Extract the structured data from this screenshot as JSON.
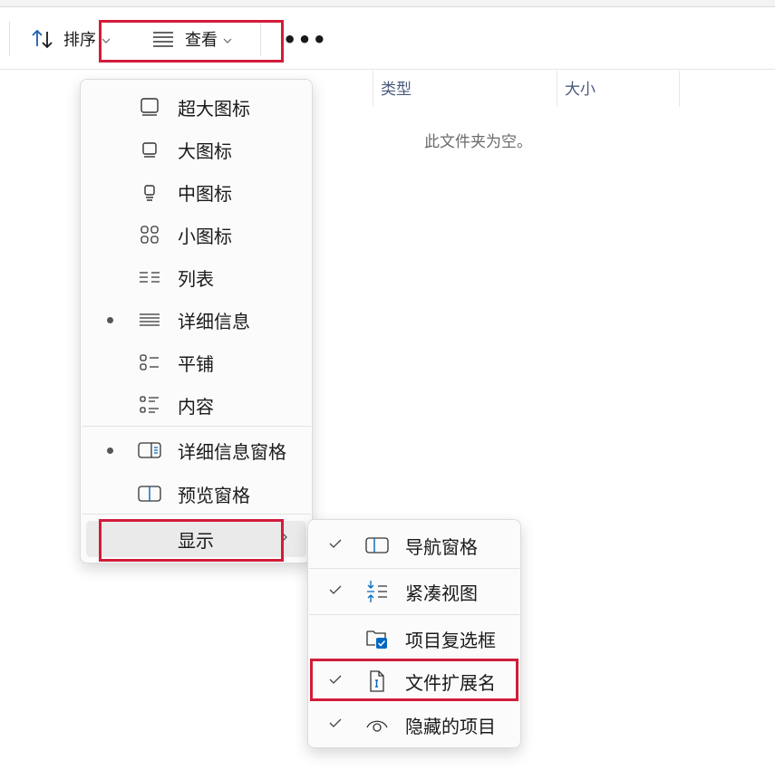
{
  "toolbar": {
    "sort_label": "排序",
    "view_label": "查看",
    "more_label": "•••"
  },
  "columns": [
    {
      "label": "类型"
    },
    {
      "label": "大小"
    }
  ],
  "empty_message": "此文件夹为空。",
  "view_menu": {
    "items": [
      {
        "label": "超大图标",
        "icon": "extra-large-icons-icon",
        "selected": false
      },
      {
        "label": "大图标",
        "icon": "large-icons-icon",
        "selected": false
      },
      {
        "label": "中图标",
        "icon": "medium-icons-icon",
        "selected": false
      },
      {
        "label": "小图标",
        "icon": "small-icons-icon",
        "selected": false
      },
      {
        "label": "列表",
        "icon": "list-icon",
        "selected": false
      },
      {
        "label": "详细信息",
        "icon": "details-icon",
        "selected": true
      },
      {
        "label": "平铺",
        "icon": "tiles-icon",
        "selected": false
      },
      {
        "label": "内容",
        "icon": "content-icon",
        "selected": false
      }
    ],
    "panes": [
      {
        "label": "详细信息窗格",
        "icon": "details-pane-icon",
        "selected": true
      },
      {
        "label": "预览窗格",
        "icon": "preview-pane-icon",
        "selected": false
      }
    ],
    "show_label": "显示"
  },
  "show_submenu": {
    "items": [
      {
        "label": "导航窗格",
        "icon": "navigation-pane-icon",
        "checked": true
      },
      {
        "label": "紧凑视图",
        "icon": "compact-view-icon",
        "checked": true
      },
      {
        "label": "项目复选框",
        "icon": "item-checkboxes-icon",
        "checked": false
      },
      {
        "label": "文件扩展名",
        "icon": "file-extensions-icon",
        "checked": true
      },
      {
        "label": "隐藏的项目",
        "icon": "hidden-items-icon",
        "checked": true
      }
    ]
  },
  "colors": {
    "accent": "#0067c0",
    "highlight_border": "#d21c3a"
  }
}
